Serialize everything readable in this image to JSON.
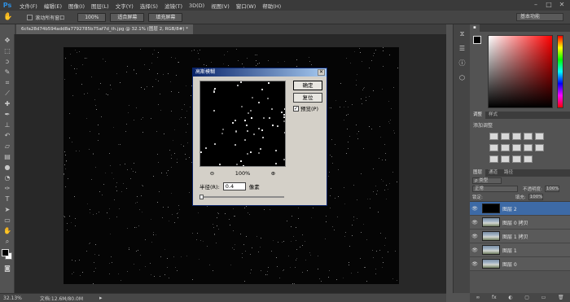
{
  "app": {
    "logo": "Ps"
  },
  "menubar": {
    "items": [
      "文件(F)",
      "编辑(E)",
      "图像(I)",
      "图层(L)",
      "文字(Y)",
      "选择(S)",
      "滤镜(T)",
      "3D(D)",
      "视图(V)",
      "窗口(W)",
      "帮助(H)"
    ],
    "window_controls": [
      "–",
      "□",
      "✕"
    ]
  },
  "options_bar": {
    "scroll_all_label": "滚动所有窗口",
    "buttons": [
      "100%",
      "适合屏幕",
      "填充屏幕"
    ],
    "workspace": "基本功能"
  },
  "document": {
    "tab_title": "6cfa28d74b594add8a7792785b75af7d_th.jpg @ 32.1% (图层 2, RGB/8#) *"
  },
  "status": {
    "zoom": "32.13%",
    "doc_size": "文档:12.6M/80.0M"
  },
  "dialog": {
    "title": "高斯模糊",
    "ok_label": "确定",
    "reset_label": "复位",
    "preview_label": "预览(P)",
    "preview_checked": true,
    "zoom_out": "⊖",
    "zoom_level": "100%",
    "zoom_in": "⊕",
    "radius_label": "半径(R):",
    "radius_value": "0.4",
    "radius_unit": "像素"
  },
  "adjustments": {
    "tabs": [
      "调整",
      "样式"
    ],
    "add_label": "添加调整"
  },
  "layers_panel": {
    "tabs": [
      "图层",
      "通道",
      "路径"
    ],
    "kind_label": "ρ 类型",
    "blend_mode": "正常",
    "opacity_label": "不透明度:",
    "opacity_value": "100%",
    "lock_label": "锁定:",
    "fill_label": "填充:",
    "fill_value": "100%",
    "layers": [
      {
        "name": "图层 2",
        "selected": true,
        "thumb": "black"
      },
      {
        "name": "图层 0 拷贝",
        "selected": false,
        "thumb": "photo"
      },
      {
        "name": "图层 1 拷贝",
        "selected": false,
        "thumb": "photo"
      },
      {
        "name": "图层 1",
        "selected": false,
        "thumb": "photo"
      },
      {
        "name": "图层 0",
        "selected": false,
        "thumb": "photo"
      }
    ],
    "footer_icons": [
      "∞",
      "fx",
      "◐",
      "▢",
      "▭",
      "🗑"
    ]
  }
}
